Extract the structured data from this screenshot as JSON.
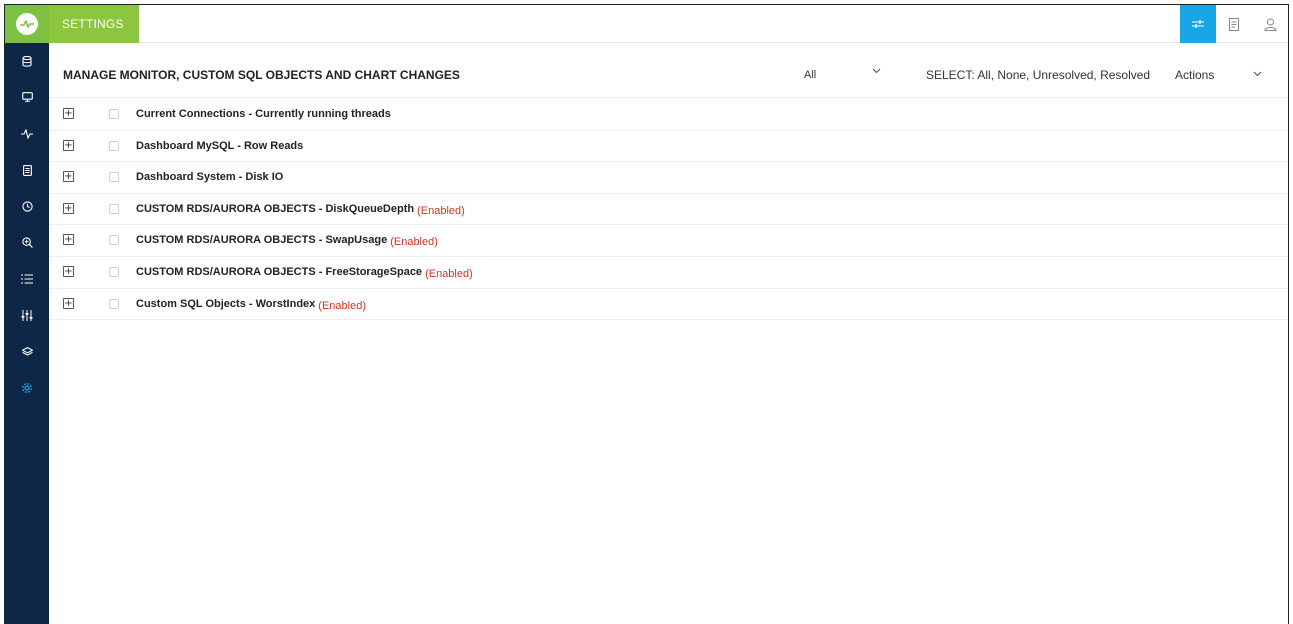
{
  "topbar": {
    "tab_label": "SETTINGS",
    "icons": [
      "sliders-icon",
      "document-icon",
      "user-icon"
    ],
    "active_color": "#1aa6e6",
    "brand_color": "#8cc63f"
  },
  "sidebar": {
    "background": "#0f2747",
    "items": [
      {
        "icon": "database-icon"
      },
      {
        "icon": "monitor-icon"
      },
      {
        "icon": "pulse-icon"
      },
      {
        "icon": "report-icon"
      },
      {
        "icon": "clock-icon"
      },
      {
        "icon": "zoom-icon"
      },
      {
        "icon": "list-icon"
      },
      {
        "icon": "sliders-icon"
      },
      {
        "icon": "layers-icon"
      },
      {
        "icon": "gear-icon",
        "active": true
      }
    ]
  },
  "main": {
    "title": "MANAGE MONITOR, CUSTOM SQL OBJECTS AND CHART CHANGES",
    "filter_value": "All",
    "select_links": "SELECT: All, None, Unresolved, Resolved",
    "actions_label": "Actions",
    "rows": [
      {
        "label": "Current Connections - Currently running threads",
        "status": ""
      },
      {
        "label": "Dashboard MySQL - Row Reads",
        "status": ""
      },
      {
        "label": "Dashboard System - Disk IO",
        "status": ""
      },
      {
        "label": "CUSTOM RDS/AURORA OBJECTS - DiskQueueDepth",
        "status": "(Enabled)"
      },
      {
        "label": "CUSTOM RDS/AURORA OBJECTS - SwapUsage",
        "status": "(Enabled)"
      },
      {
        "label": "CUSTOM RDS/AURORA OBJECTS - FreeStorageSpace",
        "status": "(Enabled)"
      },
      {
        "label": "Custom SQL Objects - WorstIndex",
        "status": "(Enabled)"
      }
    ],
    "status_color": "#d0342c"
  }
}
